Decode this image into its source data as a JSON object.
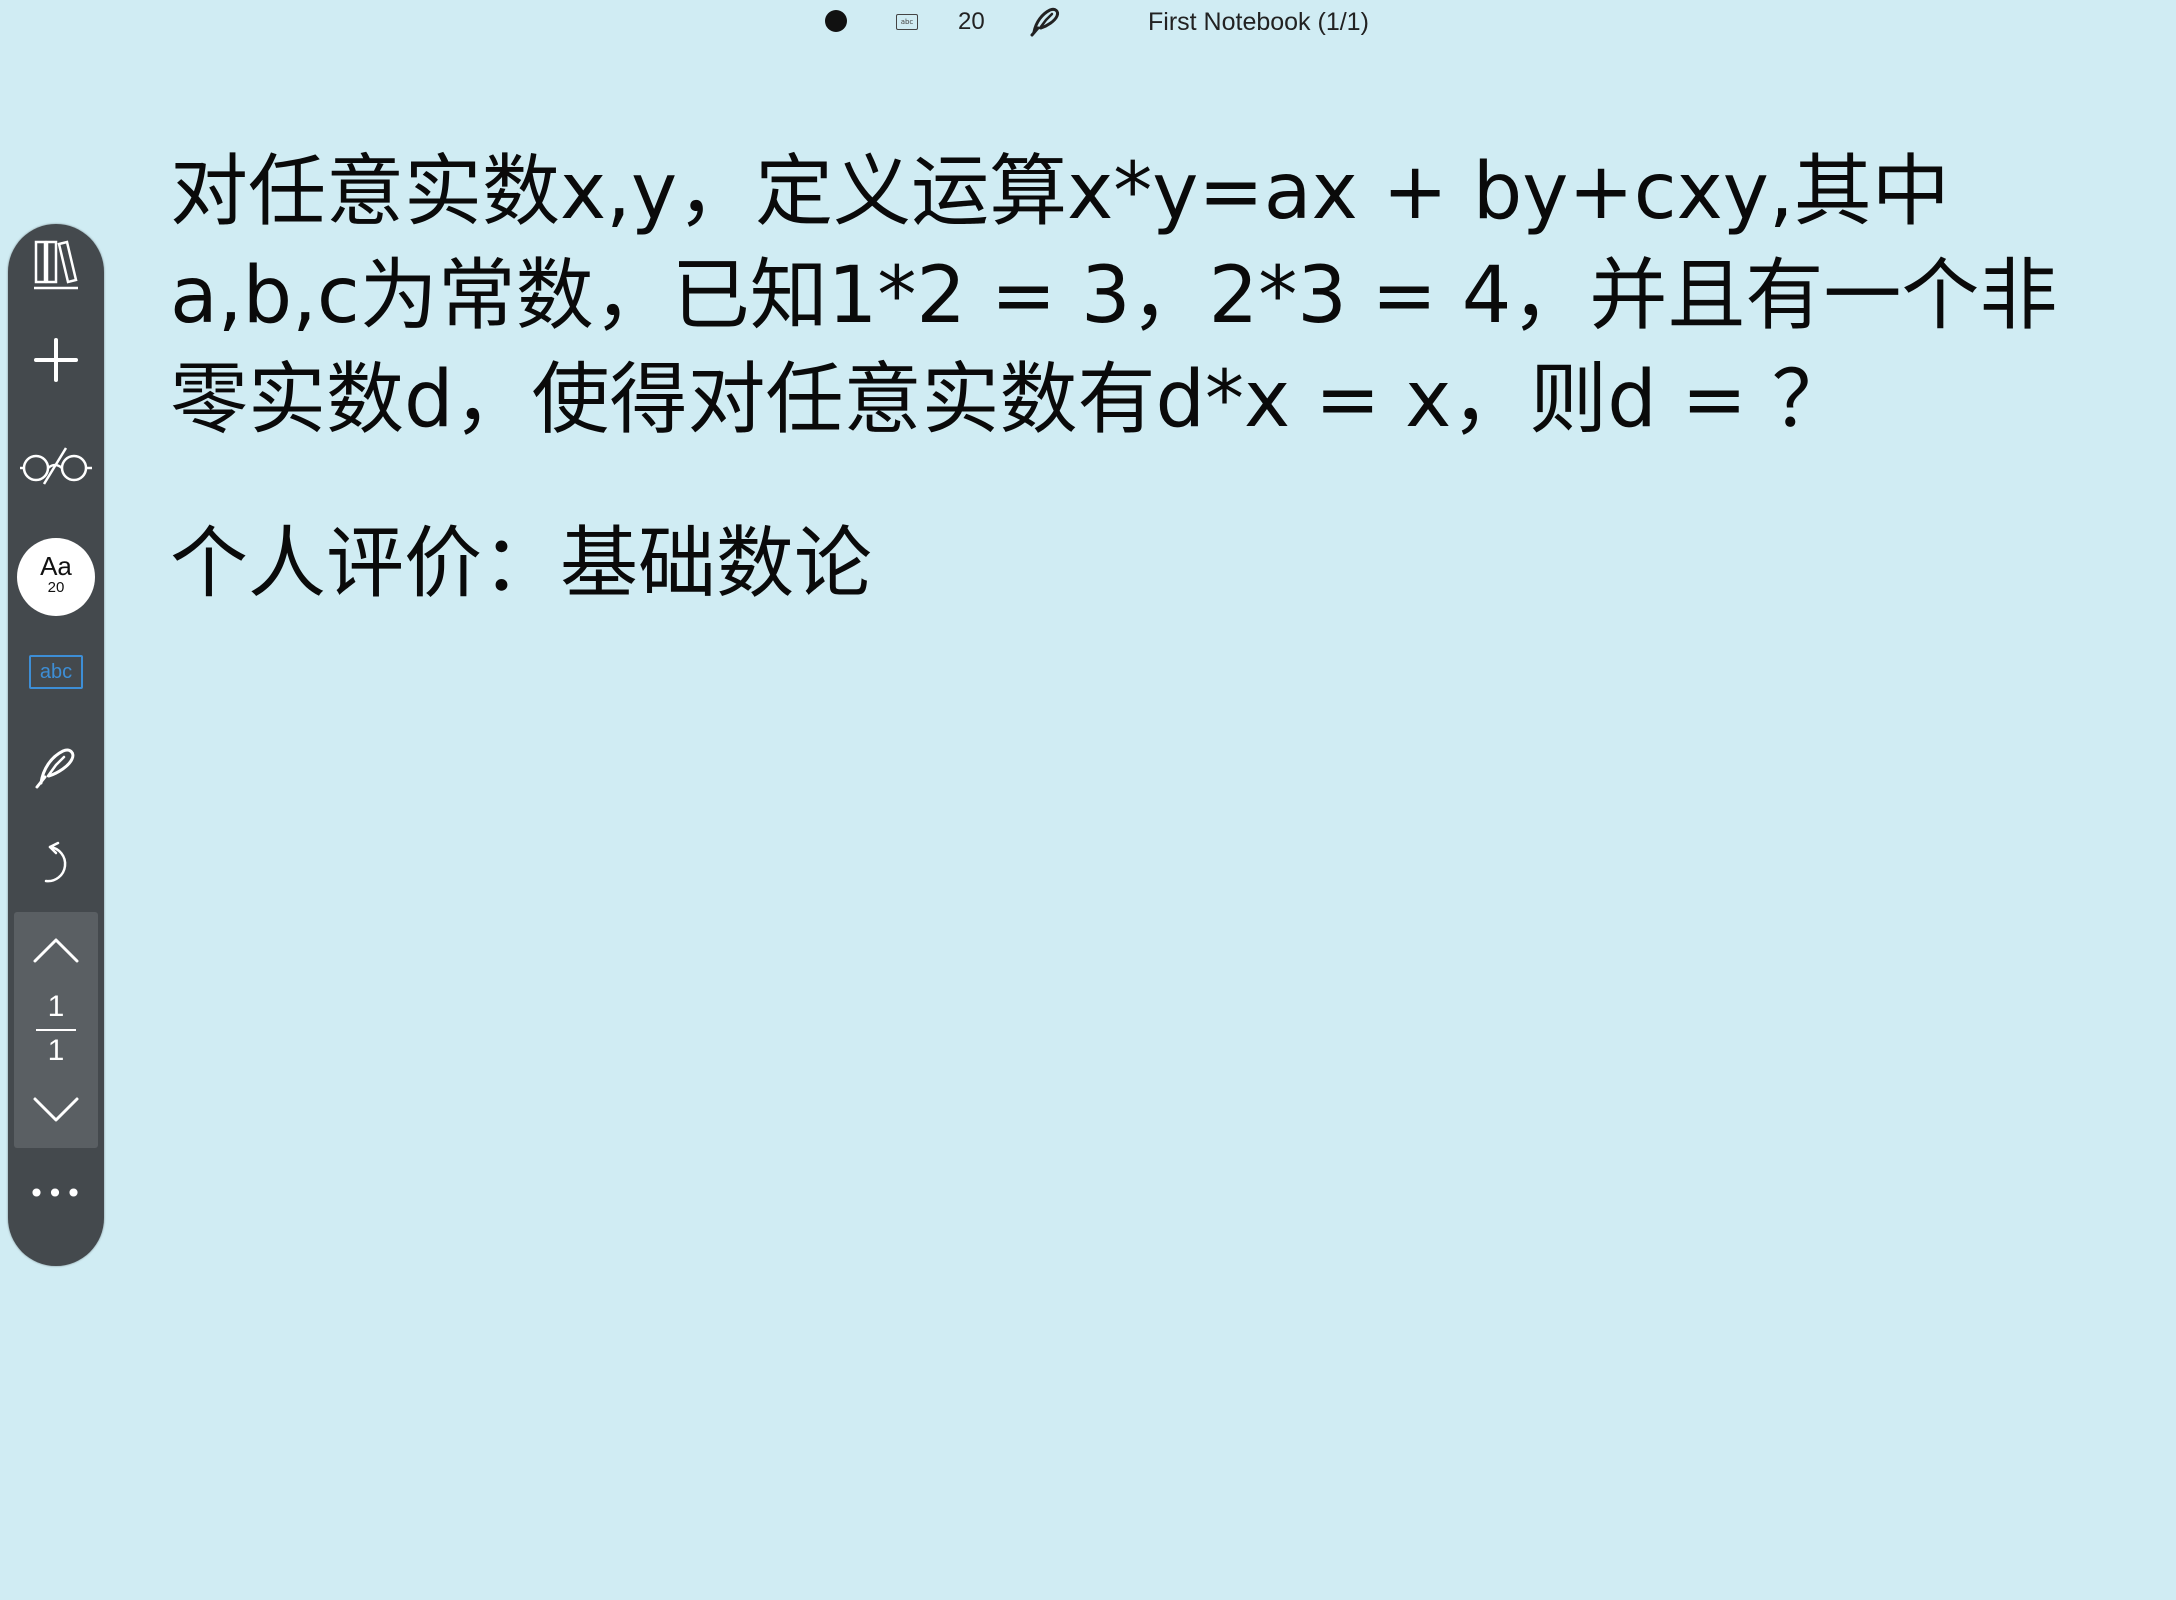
{
  "status_bar": {
    "font_size": "20",
    "notebook_title": "First Notebook (1/1)",
    "abc_label": "abc"
  },
  "sidebar": {
    "font_button": {
      "label": "Aa",
      "size": "20"
    },
    "abc_label": "abc",
    "pager": {
      "current": "1",
      "total": "1"
    },
    "more_label": "•••"
  },
  "document": {
    "problem": "对任意实数x,y，定义运算x*y=ax + by+cxy,其中a,b,c为常数，已知1*2 = 3，2*3 = 4，并且有一个非零实数d，使得对任意实数有d*x = x，则d = ？",
    "comment": "个人评价：基础数论"
  },
  "colors": {
    "background": "#d0ecf3",
    "sidebar": "#44494d",
    "accent_blue": "#3d8ed6"
  }
}
